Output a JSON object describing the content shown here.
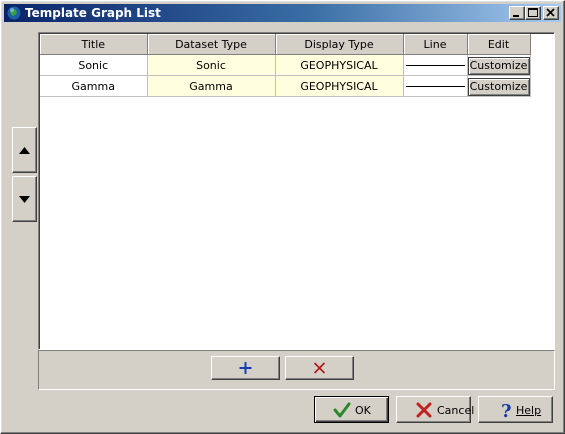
{
  "window": {
    "title": "Template Graph List",
    "controls": [
      "minimize",
      "maximize",
      "close"
    ]
  },
  "grid": {
    "columns": [
      "Title",
      "Dataset Type",
      "Display Type",
      "Line",
      "Edit"
    ],
    "rows": [
      {
        "title": "Sonic",
        "dataset_type": "Sonic",
        "display_type": "GEOPHYSICAL",
        "line": "solid-black",
        "edit_label": "Customize"
      },
      {
        "title": "Gamma",
        "dataset_type": "Gamma",
        "display_type": "GEOPHYSICAL",
        "line": "solid-black",
        "edit_label": "Customize"
      }
    ]
  },
  "side_buttons": {
    "up_icon": "arrow-up-icon",
    "down_icon": "arrow-down-icon"
  },
  "toolbar": {
    "add_icon": "plus-icon",
    "delete_icon": "x-icon"
  },
  "dialog_buttons": {
    "ok_label": "OK",
    "cancel_label": "Cancel",
    "help_label": "Help"
  },
  "colors": {
    "titlebar_start": "#0a246a",
    "titlebar_end": "#a6caf0",
    "dataset_cell_bg": "#ffffe0",
    "ok_check": "#2a8a2a",
    "cancel_x": "#c02020",
    "help_q": "#1a3aa0"
  }
}
